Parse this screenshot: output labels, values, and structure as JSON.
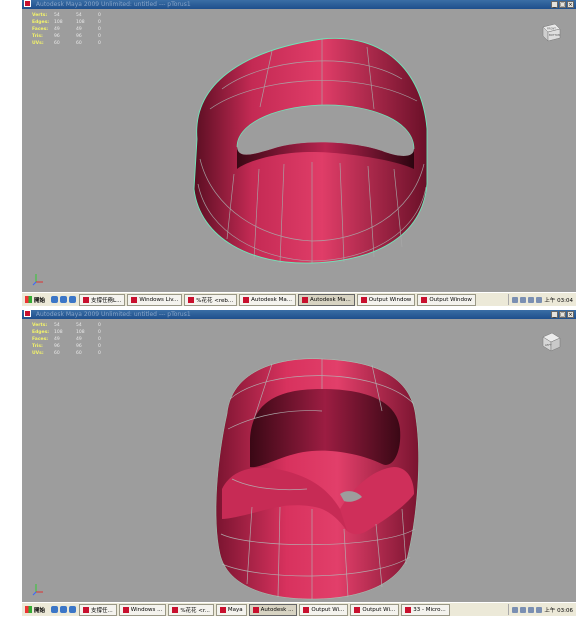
{
  "panels": [
    {
      "title": "Autodesk Maya 2009 Unlimited: untitled    ---   pTorus1",
      "hud": [
        {
          "label": "Verts:",
          "a": "54",
          "b": "54",
          "c": "0"
        },
        {
          "label": "Edges:",
          "a": "108",
          "b": "108",
          "c": "0"
        },
        {
          "label": "Faces:",
          "a": "49",
          "b": "49",
          "c": "0"
        },
        {
          "label": "Tris:",
          "a": "96",
          "b": "96",
          "c": "0"
        },
        {
          "label": "UVs:",
          "a": "60",
          "b": "60",
          "c": "0"
        }
      ],
      "viewcube": {
        "top": "FRONT",
        "side": "BOTTOM"
      },
      "taskbar": {
        "start": "開始",
        "tasks": [
          "支撐任務L...",
          "Windows Liv...",
          "%花花 <reb...",
          "Autodesk Ma...",
          "Autodesk Ma...",
          "Output Window",
          "Output Window"
        ],
        "active_index": 4,
        "time": "上午 03:04"
      }
    },
    {
      "title": "Autodesk Maya 2009 Unlimited: untitled    ---   pTorus1",
      "hud": [
        {
          "label": "Verts:",
          "a": "54",
          "b": "54",
          "c": "0"
        },
        {
          "label": "Edges:",
          "a": "108",
          "b": "108",
          "c": "0"
        },
        {
          "label": "Faces:",
          "a": "49",
          "b": "49",
          "c": "0"
        },
        {
          "label": "Tris:",
          "a": "96",
          "b": "96",
          "c": "0"
        },
        {
          "label": "UVs:",
          "a": "60",
          "b": "60",
          "c": "0"
        }
      ],
      "viewcube": {
        "top": "",
        "side": "LEFT"
      },
      "taskbar": {
        "start": "開始",
        "tasks": [
          "支撐任...",
          "Windows ...",
          "%花花 <r...",
          "Maya",
          "Autodesk ...",
          "Output Wi...",
          "Output Wi...",
          "33 - Micro..."
        ],
        "active_index": 4,
        "time": "上午 03:06"
      }
    }
  ],
  "colors": {
    "model": "#d8325e",
    "wire": "#6fe6b8",
    "viewport": "#9d9d9d"
  }
}
